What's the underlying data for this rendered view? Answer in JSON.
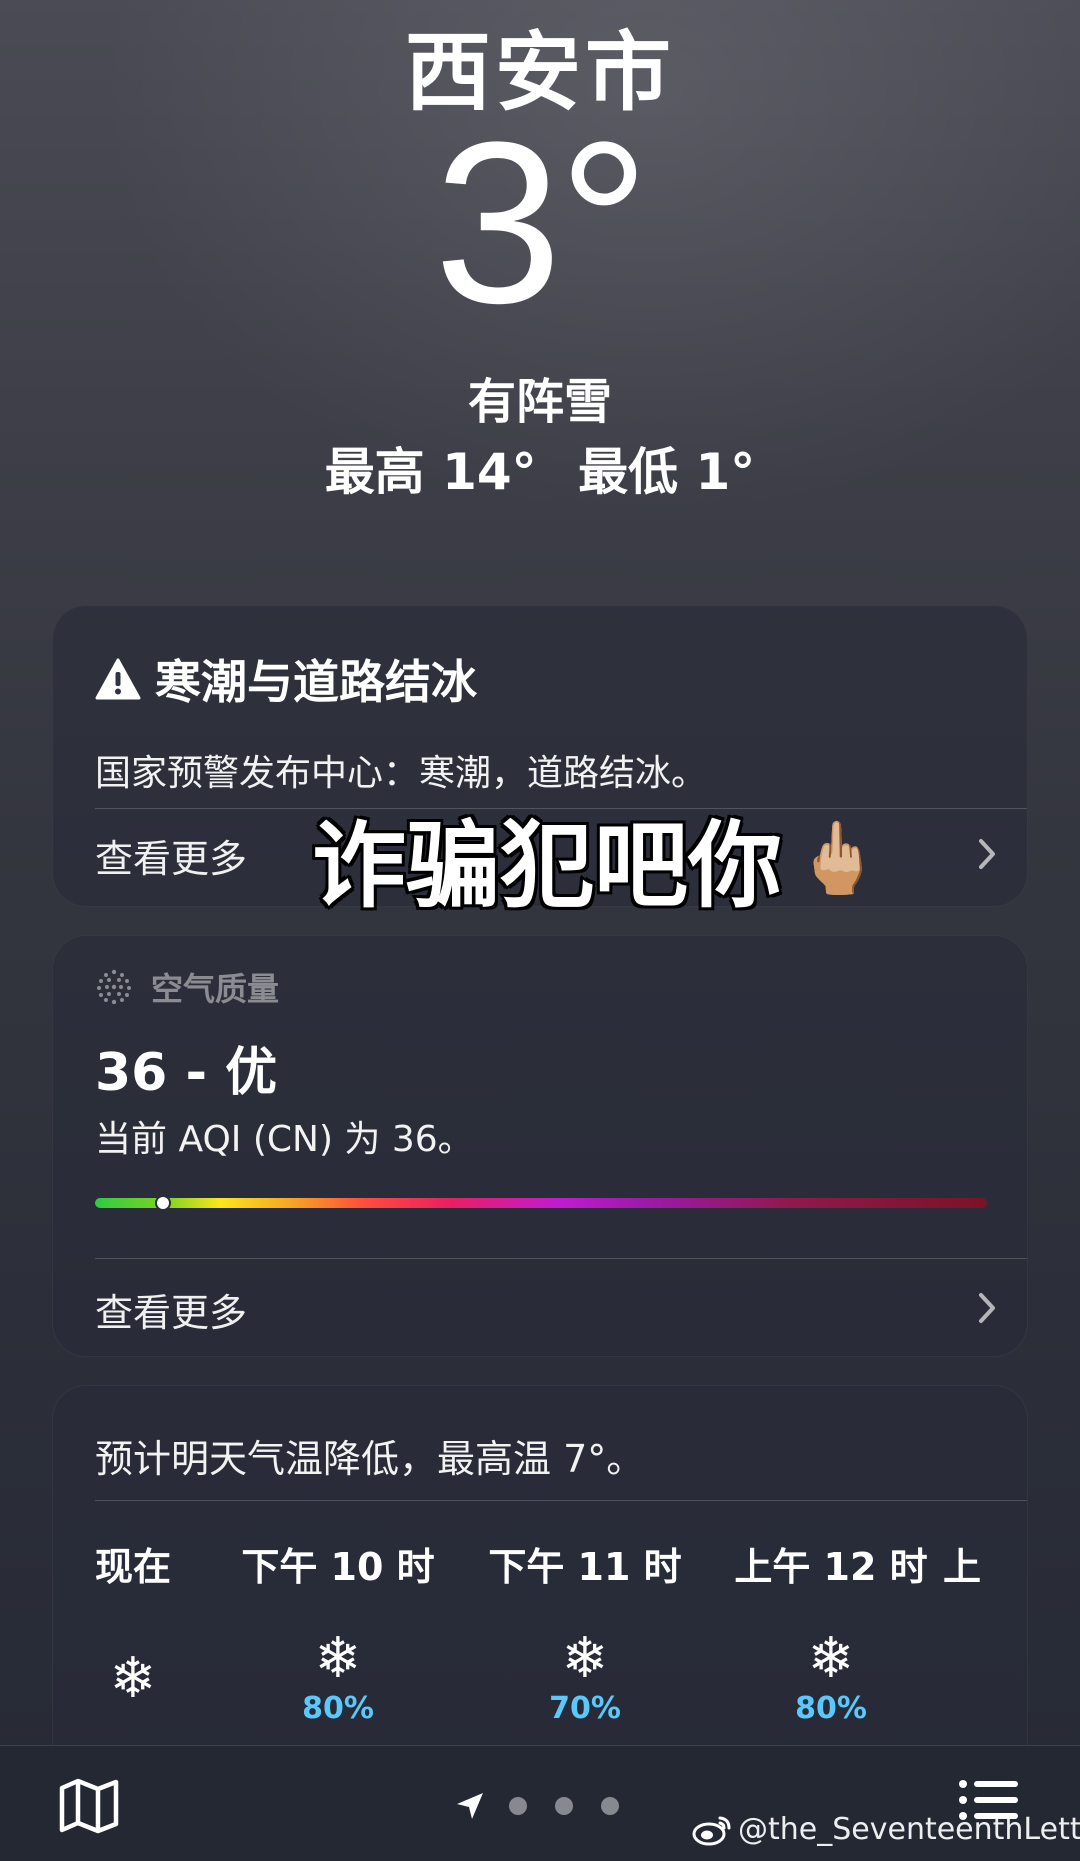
{
  "location": {
    "city": "西安市",
    "temperature": "3°",
    "condition": "有阵雪",
    "high": "最高 14°",
    "low": "最低 1°"
  },
  "alert": {
    "title": "寒潮与道路结冰",
    "body": "国家预警发布中心：寒潮，道路结冰。",
    "see_more": "查看更多"
  },
  "air_quality": {
    "label": "空气质量",
    "value_text": "36 - 优",
    "description": "当前 AQI (CN) 为 36。",
    "aqi": 36,
    "scale_fraction": 0.076,
    "see_more": "查看更多"
  },
  "hourly": {
    "summary": "预计明天气温降低，最高温 7°。",
    "items": [
      {
        "label": "现在",
        "icon": "❄",
        "precip": ""
      },
      {
        "label": "下午 10 时",
        "icon": "❄",
        "precip": "80%"
      },
      {
        "label": "下午 11 时",
        "icon": "❄",
        "precip": "70%"
      },
      {
        "label": "上午 12 时",
        "icon": "❄",
        "precip": "80%"
      },
      {
        "label": "上",
        "icon": "",
        "precip": ""
      }
    ]
  },
  "overlay_caption": {
    "text": "诈骗犯吧你",
    "emoji": "🖕🏼"
  },
  "watermark": "@the_SeventeenthLetter",
  "colors": {
    "precip": "#5ac8fa",
    "aqi_marker": "#ffffff"
  }
}
